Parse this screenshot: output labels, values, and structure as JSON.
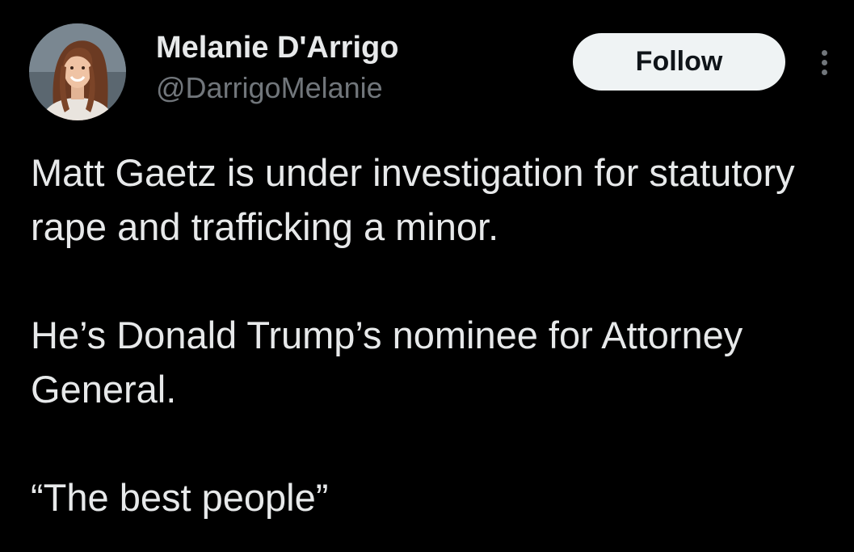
{
  "user": {
    "display_name": "Melanie D'Arrigo",
    "handle": "@DarrigoMelanie",
    "avatar_icon": "profile-photo"
  },
  "actions": {
    "follow_label": "Follow",
    "more_icon": "more-vertical-icon"
  },
  "tweet": {
    "paragraphs": [
      "Matt Gaetz is under investigation for statutory rape and trafficking a minor.",
      "He’s Donald Trump’s nominee for Attorney General.",
      "“The best people”"
    ]
  },
  "colors": {
    "background": "#000000",
    "primary_text": "#e7e9ea",
    "secondary_text": "#71767b",
    "follow_bg": "#eff3f4",
    "follow_text": "#0f1419"
  }
}
